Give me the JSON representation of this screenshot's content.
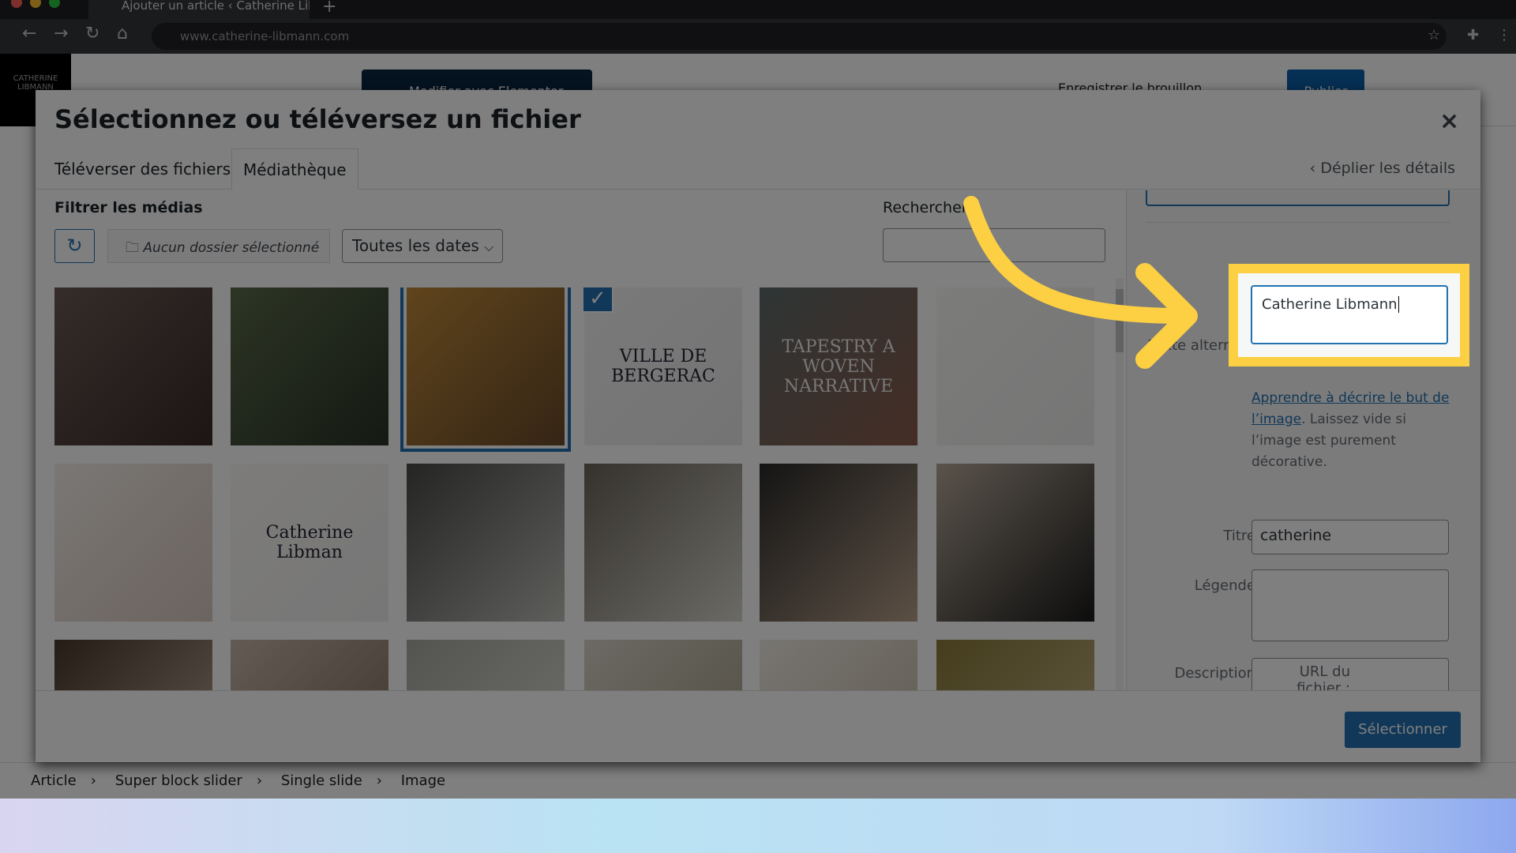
{
  "browser": {
    "tab_title": "Ajouter un article ‹ Catherine Libn",
    "url": "www.catherine-libmann.com",
    "new_tab": "+"
  },
  "editor": {
    "logo": "CATHERINE LIBMANN",
    "elementor_button": "Modifier avec Elementor",
    "save_draft": "Enregistrer le brouillon",
    "publish": "Publier",
    "breadcrumb": [
      "Article",
      "Super block slider",
      "Single slide",
      "Image"
    ]
  },
  "modal": {
    "title": "Sélectionnez ou téléversez un fichier",
    "close": "×",
    "tabs": [
      {
        "label": "Téléverser des fichiers",
        "active": false
      },
      {
        "label": "Médiathèque",
        "active": true
      }
    ],
    "details_toggle": "Déplier les détails",
    "filter_label": "Filtrer les médias",
    "folder_filter": "Aucun dossier sélectionné",
    "date_filter": "Toutes les dates",
    "search_label": "Rechercher",
    "search_value": "",
    "thumbnails": [
      {
        "colors": [
          "#6b5a55",
          "#3a2a28"
        ]
      },
      {
        "colors": [
          "#5a6a4a",
          "#2a3325"
        ]
      },
      {
        "colors": [
          "#c08a3a",
          "#6a4a2a"
        ],
        "selected": true
      },
      {
        "colors": [
          "#f4f4f4",
          "#e8e8e8"
        ],
        "text": "VILLE DE BERGERAC"
      },
      {
        "colors": [
          "#5d6a6a",
          "#8a5a4a"
        ],
        "text": "TAPESTRY A WOVEN NARRATIVE"
      },
      {
        "colors": [
          "#f8f8f4",
          "#ececec"
        ]
      },
      {
        "colors": [
          "#f4efea",
          "#d8c8be"
        ]
      },
      {
        "colors": [
          "#faf8f4",
          "#eeeeee"
        ],
        "text": "Catherine Libman"
      },
      {
        "colors": [
          "#4a4a48",
          "#bdbdb8"
        ]
      },
      {
        "colors": [
          "#6a6558",
          "#d8d4cc"
        ]
      },
      {
        "colors": [
          "#2a2a2a",
          "#b8a08a"
        ]
      },
      {
        "colors": [
          "#b5a898",
          "#1a1a1a"
        ]
      },
      {
        "colors": [
          "#4a3a2a",
          "#c8b8a8"
        ]
      },
      {
        "colors": [
          "#c8b8a8",
          "#7a6a5a"
        ]
      },
      {
        "colors": [
          "#a8a8a0",
          "#e0e0d8"
        ]
      },
      {
        "colors": [
          "#d8d4c8",
          "#a09880"
        ]
      },
      {
        "colors": [
          "#f0ece4",
          "#c0b4a0"
        ]
      },
      {
        "colors": [
          "#8a7a3a",
          "#c8b88a"
        ]
      }
    ],
    "details": {
      "alt_label": "Texte alternatif",
      "alt_value": "Catherine Libmann",
      "help_link": "Apprendre à décrire le but de l’image",
      "help_text": ". Laissez vide si l’image est purement décorative.",
      "title_label": "Titre",
      "title_value": "catherine",
      "caption_label": "Légende",
      "caption_value": "",
      "description_label": "Description",
      "description_value": "",
      "url_label": "URL du fichier :"
    },
    "select_button": "Sélectionner"
  },
  "annotation": {
    "highlight_color": "#fdd043"
  }
}
